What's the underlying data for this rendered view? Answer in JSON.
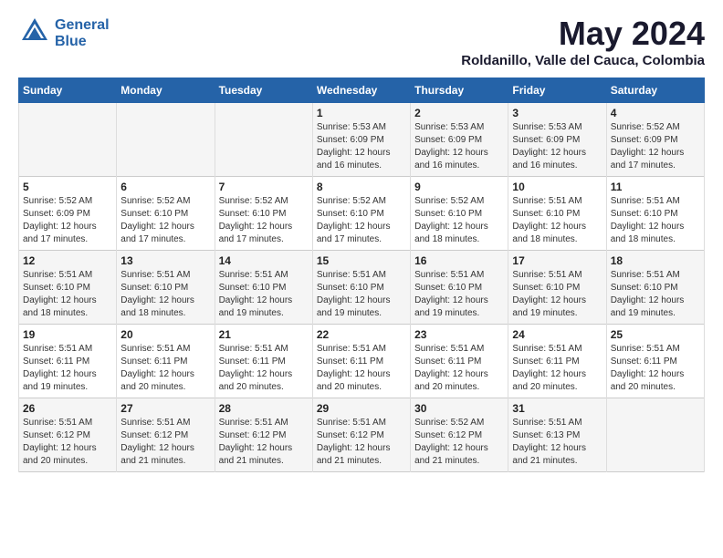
{
  "logo": {
    "line1": "General",
    "line2": "Blue"
  },
  "title": "May 2024",
  "location": "Roldanillo, Valle del Cauca, Colombia",
  "days_of_week": [
    "Sunday",
    "Monday",
    "Tuesday",
    "Wednesday",
    "Thursday",
    "Friday",
    "Saturday"
  ],
  "weeks": [
    [
      {
        "day": "",
        "info": ""
      },
      {
        "day": "",
        "info": ""
      },
      {
        "day": "",
        "info": ""
      },
      {
        "day": "1",
        "info": "Sunrise: 5:53 AM\nSunset: 6:09 PM\nDaylight: 12 hours\nand 16 minutes."
      },
      {
        "day": "2",
        "info": "Sunrise: 5:53 AM\nSunset: 6:09 PM\nDaylight: 12 hours\nand 16 minutes."
      },
      {
        "day": "3",
        "info": "Sunrise: 5:53 AM\nSunset: 6:09 PM\nDaylight: 12 hours\nand 16 minutes."
      },
      {
        "day": "4",
        "info": "Sunrise: 5:52 AM\nSunset: 6:09 PM\nDaylight: 12 hours\nand 17 minutes."
      }
    ],
    [
      {
        "day": "5",
        "info": "Sunrise: 5:52 AM\nSunset: 6:09 PM\nDaylight: 12 hours\nand 17 minutes."
      },
      {
        "day": "6",
        "info": "Sunrise: 5:52 AM\nSunset: 6:10 PM\nDaylight: 12 hours\nand 17 minutes."
      },
      {
        "day": "7",
        "info": "Sunrise: 5:52 AM\nSunset: 6:10 PM\nDaylight: 12 hours\nand 17 minutes."
      },
      {
        "day": "8",
        "info": "Sunrise: 5:52 AM\nSunset: 6:10 PM\nDaylight: 12 hours\nand 17 minutes."
      },
      {
        "day": "9",
        "info": "Sunrise: 5:52 AM\nSunset: 6:10 PM\nDaylight: 12 hours\nand 18 minutes."
      },
      {
        "day": "10",
        "info": "Sunrise: 5:51 AM\nSunset: 6:10 PM\nDaylight: 12 hours\nand 18 minutes."
      },
      {
        "day": "11",
        "info": "Sunrise: 5:51 AM\nSunset: 6:10 PM\nDaylight: 12 hours\nand 18 minutes."
      }
    ],
    [
      {
        "day": "12",
        "info": "Sunrise: 5:51 AM\nSunset: 6:10 PM\nDaylight: 12 hours\nand 18 minutes."
      },
      {
        "day": "13",
        "info": "Sunrise: 5:51 AM\nSunset: 6:10 PM\nDaylight: 12 hours\nand 18 minutes."
      },
      {
        "day": "14",
        "info": "Sunrise: 5:51 AM\nSunset: 6:10 PM\nDaylight: 12 hours\nand 19 minutes."
      },
      {
        "day": "15",
        "info": "Sunrise: 5:51 AM\nSunset: 6:10 PM\nDaylight: 12 hours\nand 19 minutes."
      },
      {
        "day": "16",
        "info": "Sunrise: 5:51 AM\nSunset: 6:10 PM\nDaylight: 12 hours\nand 19 minutes."
      },
      {
        "day": "17",
        "info": "Sunrise: 5:51 AM\nSunset: 6:10 PM\nDaylight: 12 hours\nand 19 minutes."
      },
      {
        "day": "18",
        "info": "Sunrise: 5:51 AM\nSunset: 6:10 PM\nDaylight: 12 hours\nand 19 minutes."
      }
    ],
    [
      {
        "day": "19",
        "info": "Sunrise: 5:51 AM\nSunset: 6:11 PM\nDaylight: 12 hours\nand 19 minutes."
      },
      {
        "day": "20",
        "info": "Sunrise: 5:51 AM\nSunset: 6:11 PM\nDaylight: 12 hours\nand 20 minutes."
      },
      {
        "day": "21",
        "info": "Sunrise: 5:51 AM\nSunset: 6:11 PM\nDaylight: 12 hours\nand 20 minutes."
      },
      {
        "day": "22",
        "info": "Sunrise: 5:51 AM\nSunset: 6:11 PM\nDaylight: 12 hours\nand 20 minutes."
      },
      {
        "day": "23",
        "info": "Sunrise: 5:51 AM\nSunset: 6:11 PM\nDaylight: 12 hours\nand 20 minutes."
      },
      {
        "day": "24",
        "info": "Sunrise: 5:51 AM\nSunset: 6:11 PM\nDaylight: 12 hours\nand 20 minutes."
      },
      {
        "day": "25",
        "info": "Sunrise: 5:51 AM\nSunset: 6:11 PM\nDaylight: 12 hours\nand 20 minutes."
      }
    ],
    [
      {
        "day": "26",
        "info": "Sunrise: 5:51 AM\nSunset: 6:12 PM\nDaylight: 12 hours\nand 20 minutes."
      },
      {
        "day": "27",
        "info": "Sunrise: 5:51 AM\nSunset: 6:12 PM\nDaylight: 12 hours\nand 21 minutes."
      },
      {
        "day": "28",
        "info": "Sunrise: 5:51 AM\nSunset: 6:12 PM\nDaylight: 12 hours\nand 21 minutes."
      },
      {
        "day": "29",
        "info": "Sunrise: 5:51 AM\nSunset: 6:12 PM\nDaylight: 12 hours\nand 21 minutes."
      },
      {
        "day": "30",
        "info": "Sunrise: 5:52 AM\nSunset: 6:12 PM\nDaylight: 12 hours\nand 21 minutes."
      },
      {
        "day": "31",
        "info": "Sunrise: 5:51 AM\nSunset: 6:13 PM\nDaylight: 12 hours\nand 21 minutes."
      },
      {
        "day": "",
        "info": ""
      }
    ]
  ]
}
